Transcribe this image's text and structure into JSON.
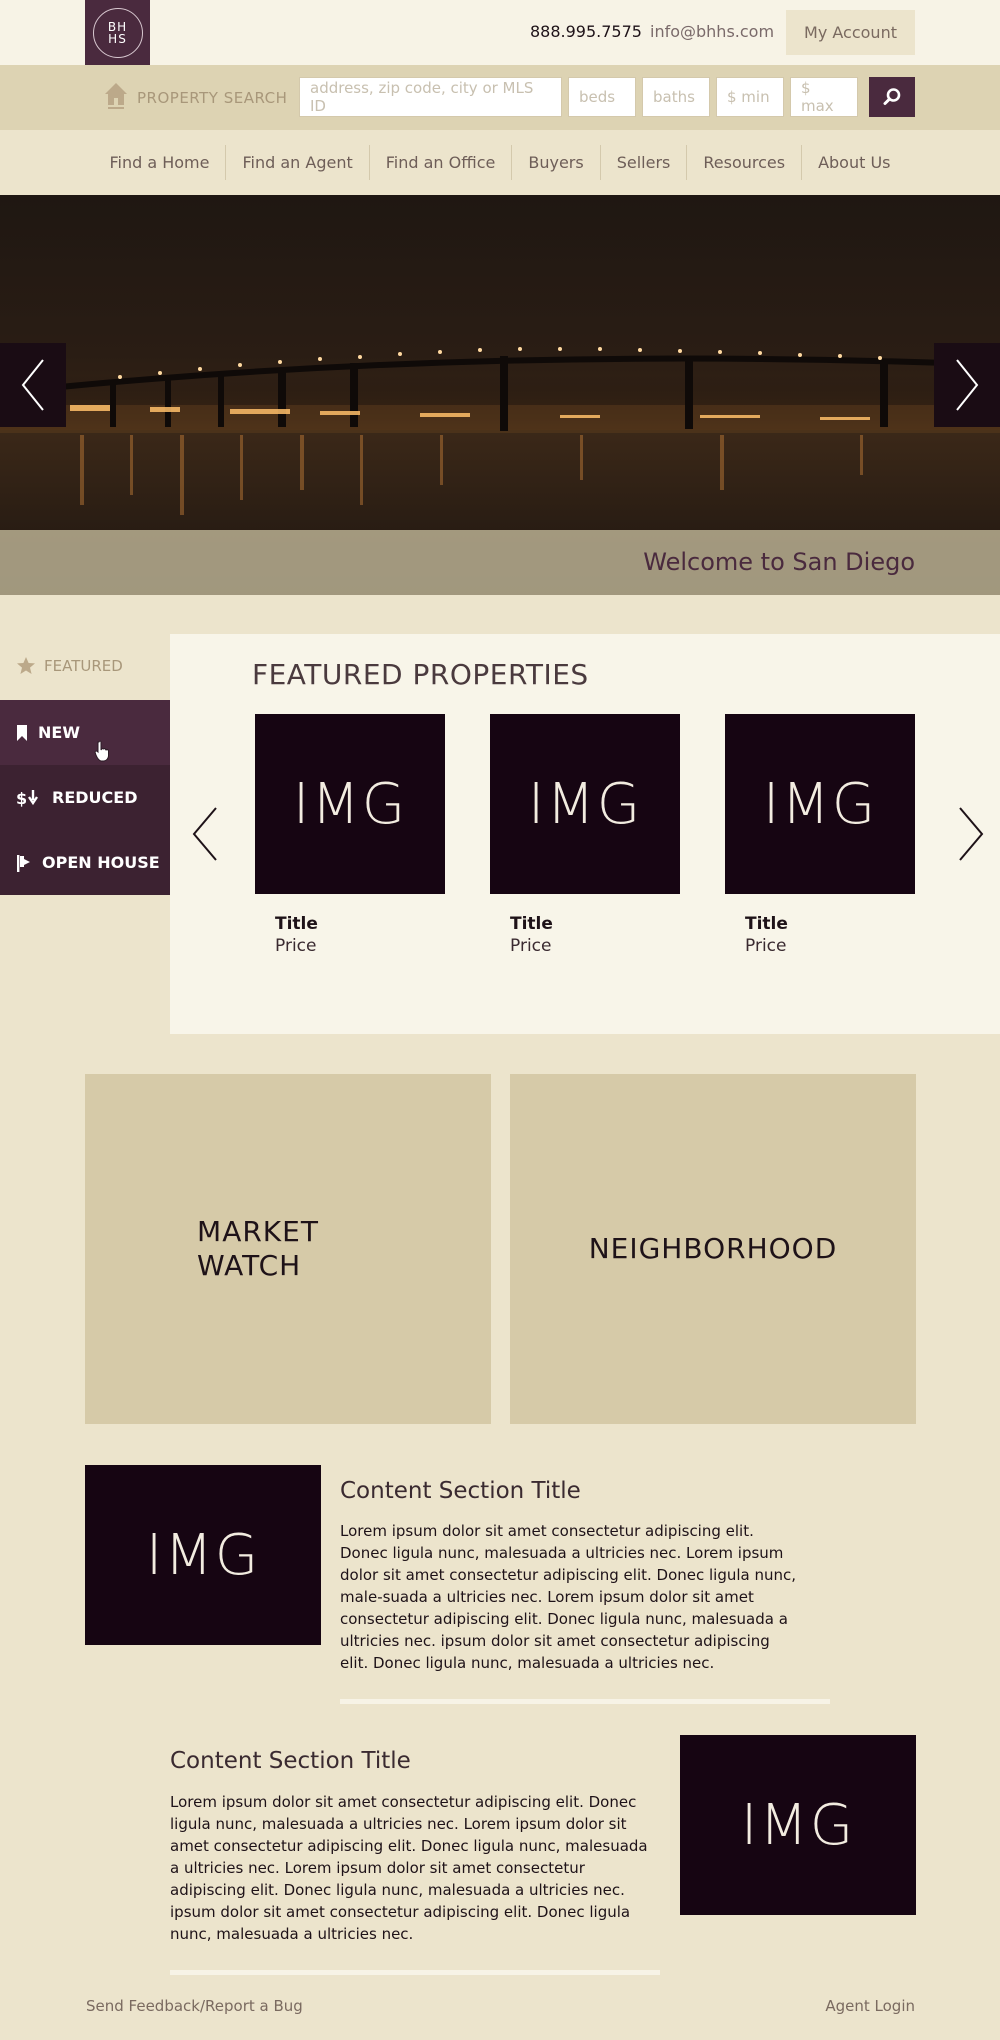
{
  "header": {
    "logo_text": "BH\nHS",
    "phone": "888.995.7575",
    "email": "info@bhhs.com",
    "account_label": "My Account"
  },
  "search": {
    "label": "PROPERTY SEARCH",
    "address_placeholder": "address, zip code, city or MLS ID",
    "beds_placeholder": "beds",
    "baths_placeholder": "baths",
    "min_placeholder": "$ min",
    "max_placeholder": "$ max",
    "button_icon": "search-icon"
  },
  "nav": {
    "items": [
      "Find a Home",
      "Find an Agent",
      "Find an Office",
      "Buyers",
      "Sellers",
      "Resources",
      "About Us"
    ]
  },
  "hero": {
    "caption": "Welcome to San Diego",
    "prev_icon": "chevron-left-icon",
    "next_icon": "chevron-right-icon"
  },
  "featured": {
    "label": "FEATURED",
    "tabs": [
      {
        "label": "NEW",
        "icon": "bookmark-icon"
      },
      {
        "label": "REDUCED",
        "icon": "price-reduced-icon"
      },
      {
        "label": "OPEN HOUSE",
        "icon": "flag-icon"
      }
    ],
    "title": "FEATURED PROPERTIES",
    "cards": [
      {
        "img": "IMG",
        "title": "Title",
        "price": "Price"
      },
      {
        "img": "IMG",
        "title": "Title",
        "price": "Price"
      },
      {
        "img": "IMG",
        "title": "Title",
        "price": "Price"
      }
    ]
  },
  "tiles": {
    "market_watch_line1": "MARKET",
    "market_watch_line2": "WATCH",
    "neighborhood": "NEIGHBORHOOD"
  },
  "content_sections": [
    {
      "img": "IMG",
      "title": "Content Section Title",
      "body": "Lorem ipsum dolor sit amet consectetur adipiscing elit. Donec ligula nunc, malesuada a ultricies nec. Lorem ipsum dolor sit amet consectetur adipiscing elit. Donec ligula nunc, male-suada a ultricies nec. Lorem ipsum dolor sit amet consectetur adipiscing elit. Donec ligula nunc, malesuada a ultricies nec. ipsum dolor sit amet consectetur adipiscing elit. Donec ligula nunc, malesuada a ultricies nec."
    },
    {
      "img": "IMG",
      "title": "Content Section Title",
      "body": "Lorem ipsum dolor sit amet consectetur adipiscing elit. Donec ligula nunc, malesuada a ultricies nec. Lorem ipsum dolor sit amet consectetur adipiscing elit. Donec ligula nunc, malesuada a ultricies nec. Lorem ipsum dolor sit amet consectetur adipiscing elit. Donec ligula nunc, malesuada a ultricies nec. ipsum dolor sit amet consectetur adipiscing elit. Donec ligula nunc, malesuada a ultricies nec."
    }
  ],
  "footer": {
    "feedback": "Send Feedback/Report a Bug",
    "agent_login": "Agent Login"
  },
  "colors": {
    "brand": "#4a2a3e",
    "background": "#ece4cc",
    "tile": "#d6caa8"
  }
}
